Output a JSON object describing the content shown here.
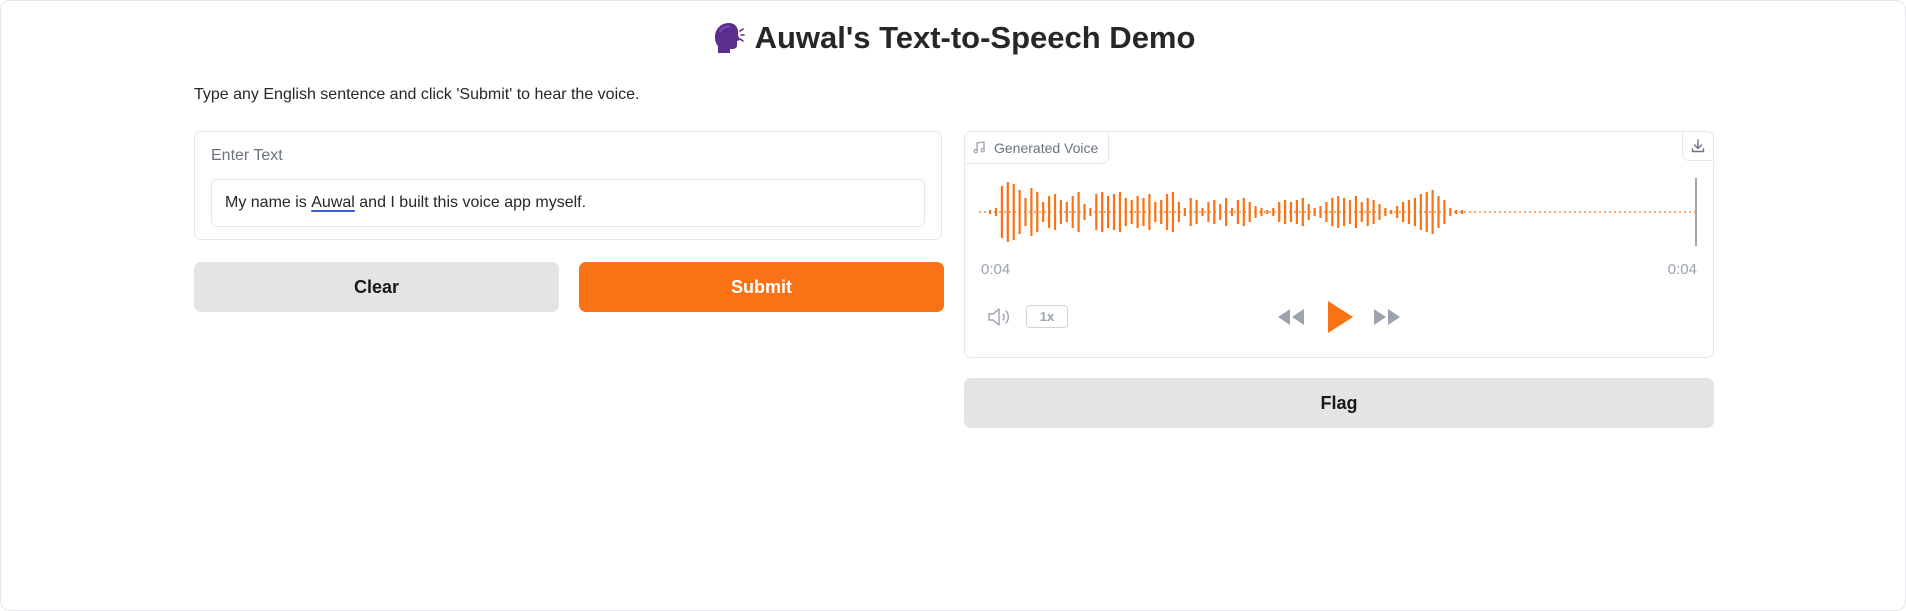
{
  "header": {
    "title": "Auwal's Text-to-Speech Demo",
    "title_icon": "speaking-head-icon",
    "description": "Type any English sentence and click 'Submit' to hear the voice."
  },
  "input": {
    "label": "Enter Text",
    "value_before": "My name is ",
    "value_underlined": "Auwal",
    "value_after": " and I built this voice app myself."
  },
  "buttons": {
    "clear": "Clear",
    "submit": "Submit",
    "flag": "Flag"
  },
  "audio": {
    "label": "Generated Voice",
    "label_icon": "music-note-icon",
    "current_time": "0:04",
    "duration": "0:04",
    "playback_speed": "1x",
    "playback_progress": 1.0,
    "icons": [
      "volume-icon",
      "rewind-icon",
      "play-icon",
      "fast-forward-icon",
      "download-icon"
    ]
  },
  "colors": {
    "accent": "#f97316",
    "secondary_button": "#e4e4e7",
    "muted_text": "#9ca3af"
  }
}
